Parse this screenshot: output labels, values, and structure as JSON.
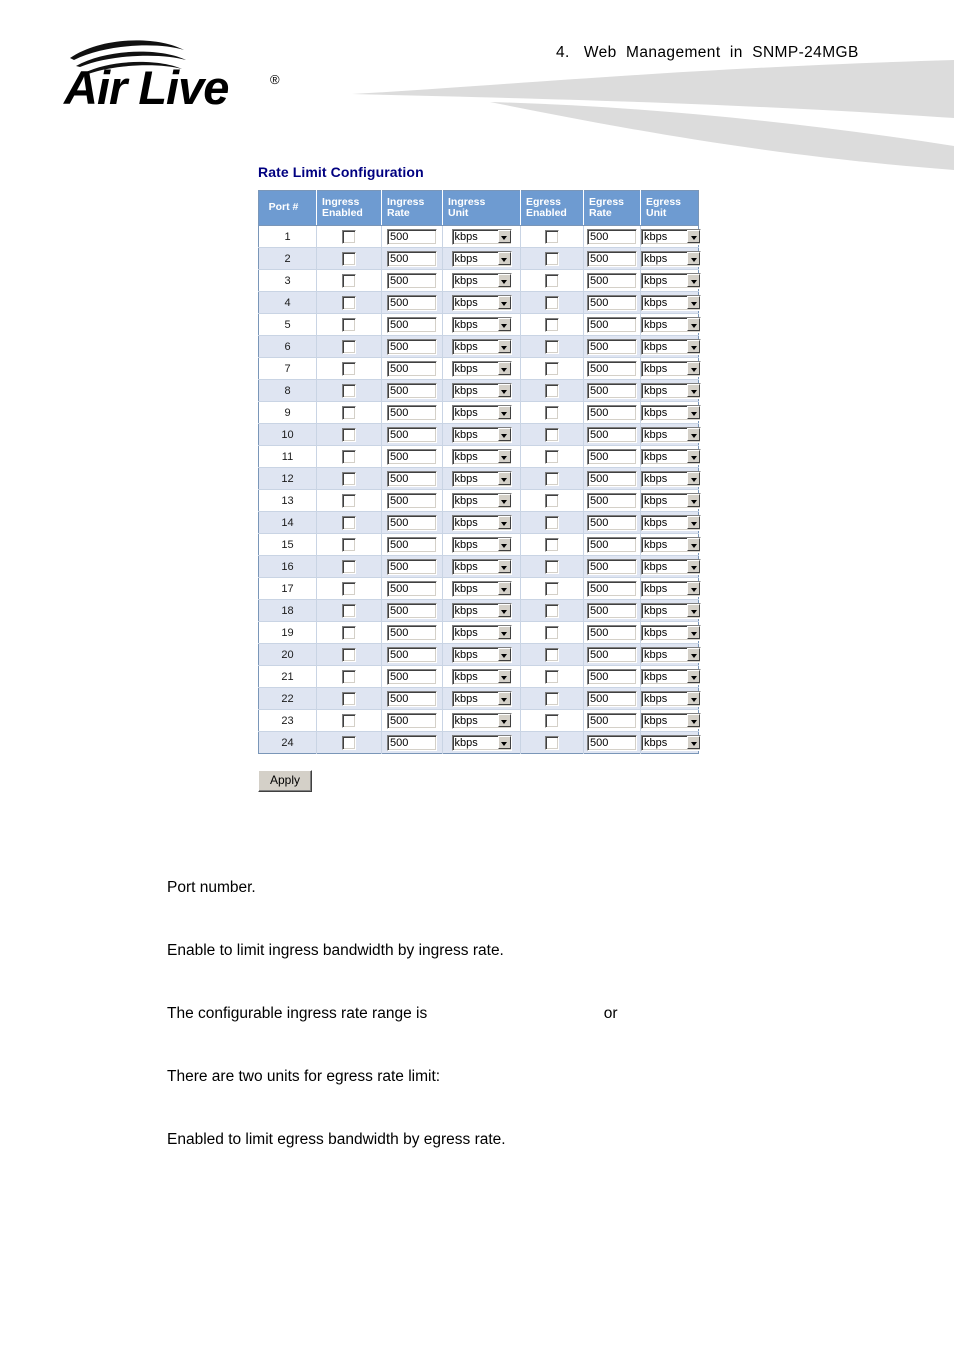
{
  "header": {
    "logo_text": "Air Live",
    "logo_tm": "®",
    "section_title": "4.   Web  Management  in  SNMP-24MGB"
  },
  "panel": {
    "title": "Rate Limit Configuration",
    "apply_label": "Apply"
  },
  "table": {
    "columns": [
      {
        "key": "port",
        "label_line1": "Port #",
        "label_line2": ""
      },
      {
        "key": "ien",
        "label_line1": "Ingress",
        "label_line2": "Enabled"
      },
      {
        "key": "irate",
        "label_line1": "Ingress",
        "label_line2": "Rate"
      },
      {
        "key": "iunit",
        "label_line1": "Ingress",
        "label_line2": "Unit"
      },
      {
        "key": "een",
        "label_line1": "Egress",
        "label_line2": "Enabled"
      },
      {
        "key": "erate",
        "label_line1": "Egress",
        "label_line2": "Rate"
      },
      {
        "key": "eunit",
        "label_line1": "Egress",
        "label_line2": "Unit"
      }
    ],
    "unit_options": [
      "kbps"
    ],
    "rows": [
      {
        "port": "1",
        "ingress_enabled": false,
        "ingress_rate": "500",
        "ingress_unit": "kbps",
        "egress_enabled": false,
        "egress_rate": "500",
        "egress_unit": "kbps"
      },
      {
        "port": "2",
        "ingress_enabled": false,
        "ingress_rate": "500",
        "ingress_unit": "kbps",
        "egress_enabled": false,
        "egress_rate": "500",
        "egress_unit": "kbps"
      },
      {
        "port": "3",
        "ingress_enabled": false,
        "ingress_rate": "500",
        "ingress_unit": "kbps",
        "egress_enabled": false,
        "egress_rate": "500",
        "egress_unit": "kbps"
      },
      {
        "port": "4",
        "ingress_enabled": false,
        "ingress_rate": "500",
        "ingress_unit": "kbps",
        "egress_enabled": false,
        "egress_rate": "500",
        "egress_unit": "kbps"
      },
      {
        "port": "5",
        "ingress_enabled": false,
        "ingress_rate": "500",
        "ingress_unit": "kbps",
        "egress_enabled": false,
        "egress_rate": "500",
        "egress_unit": "kbps"
      },
      {
        "port": "6",
        "ingress_enabled": false,
        "ingress_rate": "500",
        "ingress_unit": "kbps",
        "egress_enabled": false,
        "egress_rate": "500",
        "egress_unit": "kbps"
      },
      {
        "port": "7",
        "ingress_enabled": false,
        "ingress_rate": "500",
        "ingress_unit": "kbps",
        "egress_enabled": false,
        "egress_rate": "500",
        "egress_unit": "kbps"
      },
      {
        "port": "8",
        "ingress_enabled": false,
        "ingress_rate": "500",
        "ingress_unit": "kbps",
        "egress_enabled": false,
        "egress_rate": "500",
        "egress_unit": "kbps"
      },
      {
        "port": "9",
        "ingress_enabled": false,
        "ingress_rate": "500",
        "ingress_unit": "kbps",
        "egress_enabled": false,
        "egress_rate": "500",
        "egress_unit": "kbps"
      },
      {
        "port": "10",
        "ingress_enabled": false,
        "ingress_rate": "500",
        "ingress_unit": "kbps",
        "egress_enabled": false,
        "egress_rate": "500",
        "egress_unit": "kbps"
      },
      {
        "port": "11",
        "ingress_enabled": false,
        "ingress_rate": "500",
        "ingress_unit": "kbps",
        "egress_enabled": false,
        "egress_rate": "500",
        "egress_unit": "kbps"
      },
      {
        "port": "12",
        "ingress_enabled": false,
        "ingress_rate": "500",
        "ingress_unit": "kbps",
        "egress_enabled": false,
        "egress_rate": "500",
        "egress_unit": "kbps"
      },
      {
        "port": "13",
        "ingress_enabled": false,
        "ingress_rate": "500",
        "ingress_unit": "kbps",
        "egress_enabled": false,
        "egress_rate": "500",
        "egress_unit": "kbps"
      },
      {
        "port": "14",
        "ingress_enabled": false,
        "ingress_rate": "500",
        "ingress_unit": "kbps",
        "egress_enabled": false,
        "egress_rate": "500",
        "egress_unit": "kbps"
      },
      {
        "port": "15",
        "ingress_enabled": false,
        "ingress_rate": "500",
        "ingress_unit": "kbps",
        "egress_enabled": false,
        "egress_rate": "500",
        "egress_unit": "kbps"
      },
      {
        "port": "16",
        "ingress_enabled": false,
        "ingress_rate": "500",
        "ingress_unit": "kbps",
        "egress_enabled": false,
        "egress_rate": "500",
        "egress_unit": "kbps"
      },
      {
        "port": "17",
        "ingress_enabled": false,
        "ingress_rate": "500",
        "ingress_unit": "kbps",
        "egress_enabled": false,
        "egress_rate": "500",
        "egress_unit": "kbps"
      },
      {
        "port": "18",
        "ingress_enabled": false,
        "ingress_rate": "500",
        "ingress_unit": "kbps",
        "egress_enabled": false,
        "egress_rate": "500",
        "egress_unit": "kbps"
      },
      {
        "port": "19",
        "ingress_enabled": false,
        "ingress_rate": "500",
        "ingress_unit": "kbps",
        "egress_enabled": false,
        "egress_rate": "500",
        "egress_unit": "kbps"
      },
      {
        "port": "20",
        "ingress_enabled": false,
        "ingress_rate": "500",
        "ingress_unit": "kbps",
        "egress_enabled": false,
        "egress_rate": "500",
        "egress_unit": "kbps"
      },
      {
        "port": "21",
        "ingress_enabled": false,
        "ingress_rate": "500",
        "ingress_unit": "kbps",
        "egress_enabled": false,
        "egress_rate": "500",
        "egress_unit": "kbps"
      },
      {
        "port": "22",
        "ingress_enabled": false,
        "ingress_rate": "500",
        "ingress_unit": "kbps",
        "egress_enabled": false,
        "egress_rate": "500",
        "egress_unit": "kbps"
      },
      {
        "port": "23",
        "ingress_enabled": false,
        "ingress_rate": "500",
        "ingress_unit": "kbps",
        "egress_enabled": false,
        "egress_rate": "500",
        "egress_unit": "kbps"
      },
      {
        "port": "24",
        "ingress_enabled": false,
        "ingress_rate": "500",
        "ingress_unit": "kbps",
        "egress_enabled": false,
        "egress_rate": "500",
        "egress_unit": "kbps"
      }
    ]
  },
  "body_text": {
    "paragraphs": [
      "Port number.",
      "Enable to limit ingress bandwidth by ingress rate.",
      "The configurable ingress rate range is                                         or",
      "There are two units for egress rate limit:",
      "Enabled to limit egress bandwidth by egress rate."
    ]
  },
  "colors": {
    "table_header_bg": "#6e9bd1",
    "row_even_bg": "#dfe5f2",
    "row_odd_bg": "#ffffff",
    "panel_title": "#000080",
    "swoosh": "#dcdcdc",
    "button_face": "#d4d0c8"
  }
}
